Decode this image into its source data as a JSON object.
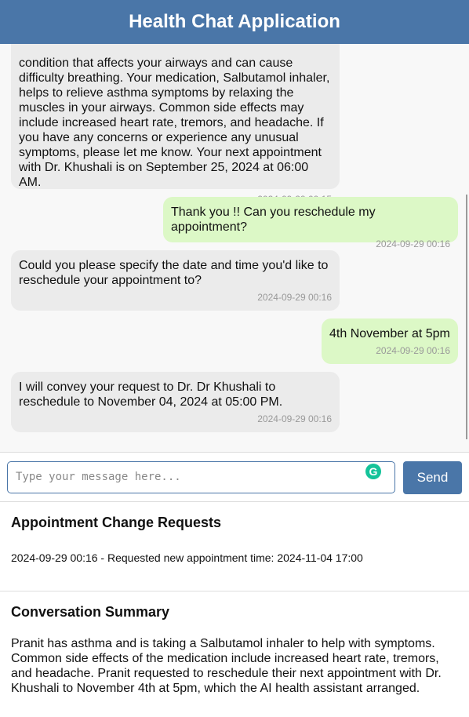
{
  "app": {
    "title": "Health Chat Application"
  },
  "chat": {
    "messages": [
      {
        "sender": "assistant",
        "text": "condition that affects your airways and can cause difficulty breathing. Your medication, Salbutamol inhaler, helps to relieve asthma symptoms by relaxing the muscles in your airways. Common side effects may include increased heart rate, tremors, and headache. If you have any concerns or experience any unusual symptoms, please let me know. Your next appointment with Dr. Khushali is on September 25, 2024 at 06:00 AM.",
        "time": "2024-09-29 00:15"
      },
      {
        "sender": "user",
        "text": "Thank you !! Can you reschedule my appointment?",
        "time": "2024-09-29 00:16"
      },
      {
        "sender": "assistant",
        "text": "Could you please specify the date and time you'd like to reschedule your appointment to?",
        "time": "2024-09-29 00:16"
      },
      {
        "sender": "user",
        "text": "4th November at 5pm",
        "time": "2024-09-29 00:16"
      },
      {
        "sender": "assistant",
        "text": "I will convey your request to Dr. Dr Khushali to reschedule to November 04, 2024 at 05:00 PM.",
        "time": "2024-09-29 00:16"
      }
    ]
  },
  "input": {
    "placeholder": "Type your message here...",
    "value": "",
    "send_label": "Send",
    "grammarly_icon": "grammarly-icon",
    "grammarly_letter": "G"
  },
  "appointments": {
    "title": "Appointment Change Requests",
    "items": [
      "2024-09-29 00:16 - Requested new appointment time: 2024-11-04 17:00"
    ]
  },
  "summary": {
    "title": "Conversation Summary",
    "text": "Pranit has asthma and is taking a Salbutamol inhaler to help with symptoms. Common side effects of the medication include increased heart rate, tremors, and headache. Pranit requested to reschedule their next appointment with Dr. Khushali to November 4th at 5pm, which the AI health assistant arranged."
  },
  "colors": {
    "header": "#4a76a8",
    "user_bubble": "#dcf8c6",
    "assistant_bubble": "#ebebeb",
    "accent": "#4a76a8"
  }
}
